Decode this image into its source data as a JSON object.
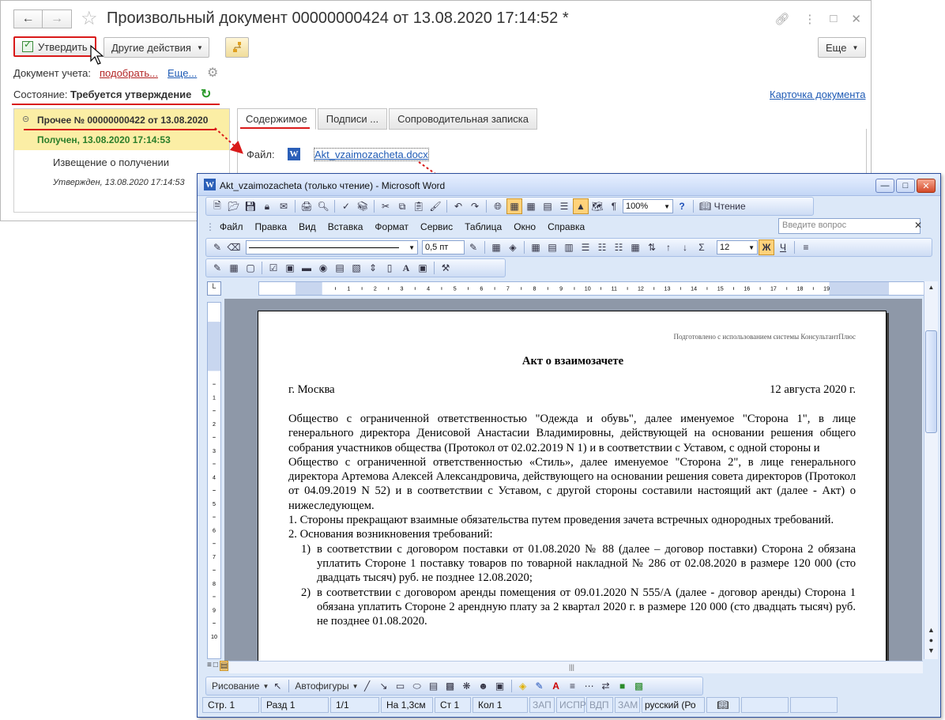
{
  "c1": {
    "title": "Произвольный документ 00000000424 от 13.08.2020 17:14:52 *",
    "back_icon": "arrow-left",
    "forward_icon": "arrow-right",
    "approve_label": "Утвердить",
    "other_actions_label": "Другие действия",
    "more_label": "Еще",
    "account_doc_label": "Документ учета:",
    "pick_link": "подобрать...",
    "more_link": "Еще...",
    "state_label": "Состояние:",
    "state_value": "Требуется утверждение",
    "card_link": "Карточка документа",
    "tree": {
      "item_title": "Прочее № 00000000422 от 13.08.2020",
      "item_received": "Получен, 13.08.2020 17:14:53",
      "notice": "Извещение о получении",
      "approved": "Утвержден, 13.08.2020 17:14:53"
    },
    "tabs": [
      "Содержимое",
      "Подписи ...",
      "Сопроводительная записка"
    ],
    "file_label": "Файл:",
    "file_name": "Akt_vzaimozacheta.docx",
    "accent_color": "#d91a1a"
  },
  "word": {
    "title": "Akt_vzaimozacheta (только чтение) - Microsoft Word",
    "read_label": "Чтение",
    "zoom": "100%",
    "menu": [
      "Файл",
      "Правка",
      "Вид",
      "Вставка",
      "Формат",
      "Сервис",
      "Таблица",
      "Окно",
      "Справка"
    ],
    "ask_placeholder": "Введите вопрос",
    "line_width": "0,5 пт",
    "font_size": "12",
    "bold": "Ж",
    "underline": "Ч",
    "drawing_label": "Рисование",
    "autoshapes_label": "Автофигуры",
    "status": {
      "page": "Стр.  1",
      "section": "Разд  1",
      "pages": "1/1",
      "pos": "На 1,3см",
      "line": "Ст  1",
      "col": "Кол  1",
      "rec": "ЗАП",
      "trk": "ИСПР",
      "ext": "ВДП",
      "ovr": "ЗАМ",
      "lang": "русский (Ро"
    }
  },
  "doc": {
    "prepared": "Подготовлено с использованием системы КонсультантПлюс",
    "heading": "Акт о взаимозачете",
    "city": "г. Москва",
    "date": "12 августа 2020 г.",
    "para1": "Общество с ограниченной ответственностью \"Одежда и обувь\", далее именуемое \"Сторона 1\", в лице генерального директора Денисовой Анастасии Владимировны, действующей на основании решения общего собрания участников общества (Протокол от 02.02.2019 N 1) и в соответствии с Уставом, с одной стороны и",
    "para2": "Общество с ограниченной ответственностью «Стиль», далее именуемое \"Сторона 2\", в лице генерального директора Артемова Алексей Александровича, действующего на основании решения совета директоров (Протокол от 04.09.2019 N 52) и в соответствии с Уставом, с другой стороны составили настоящий акт (далее - Акт) о нижеследующем.",
    "item1": "1. Стороны прекращают взаимные обязательства путем проведения зачета встречных однородных требований.",
    "item2": "2. Основания возникновения требований:",
    "sub1_num": "1)",
    "sub1": "в соответствии с договором поставки от 01.08.2020 № 88 (далее – договор поставки) Сторона 2 обязана уплатить Стороне 1 поставку товаров по товарной накладной № 286 от 02.08.2020 в размере 120 000 (сто двадцать тысяч) руб. не позднее 12.08.2020;",
    "sub2_num": "2)",
    "sub2": "в соответствии с договором аренды помещения от 09.01.2020 N 555/А (далее - договор аренды) Сторона 1 обязана уплатить Стороне 2 арендную плату за 2 квартал 2020 г. в размере 120 000 (сто двадцать тысяч) руб. не позднее 01.08.2020."
  }
}
